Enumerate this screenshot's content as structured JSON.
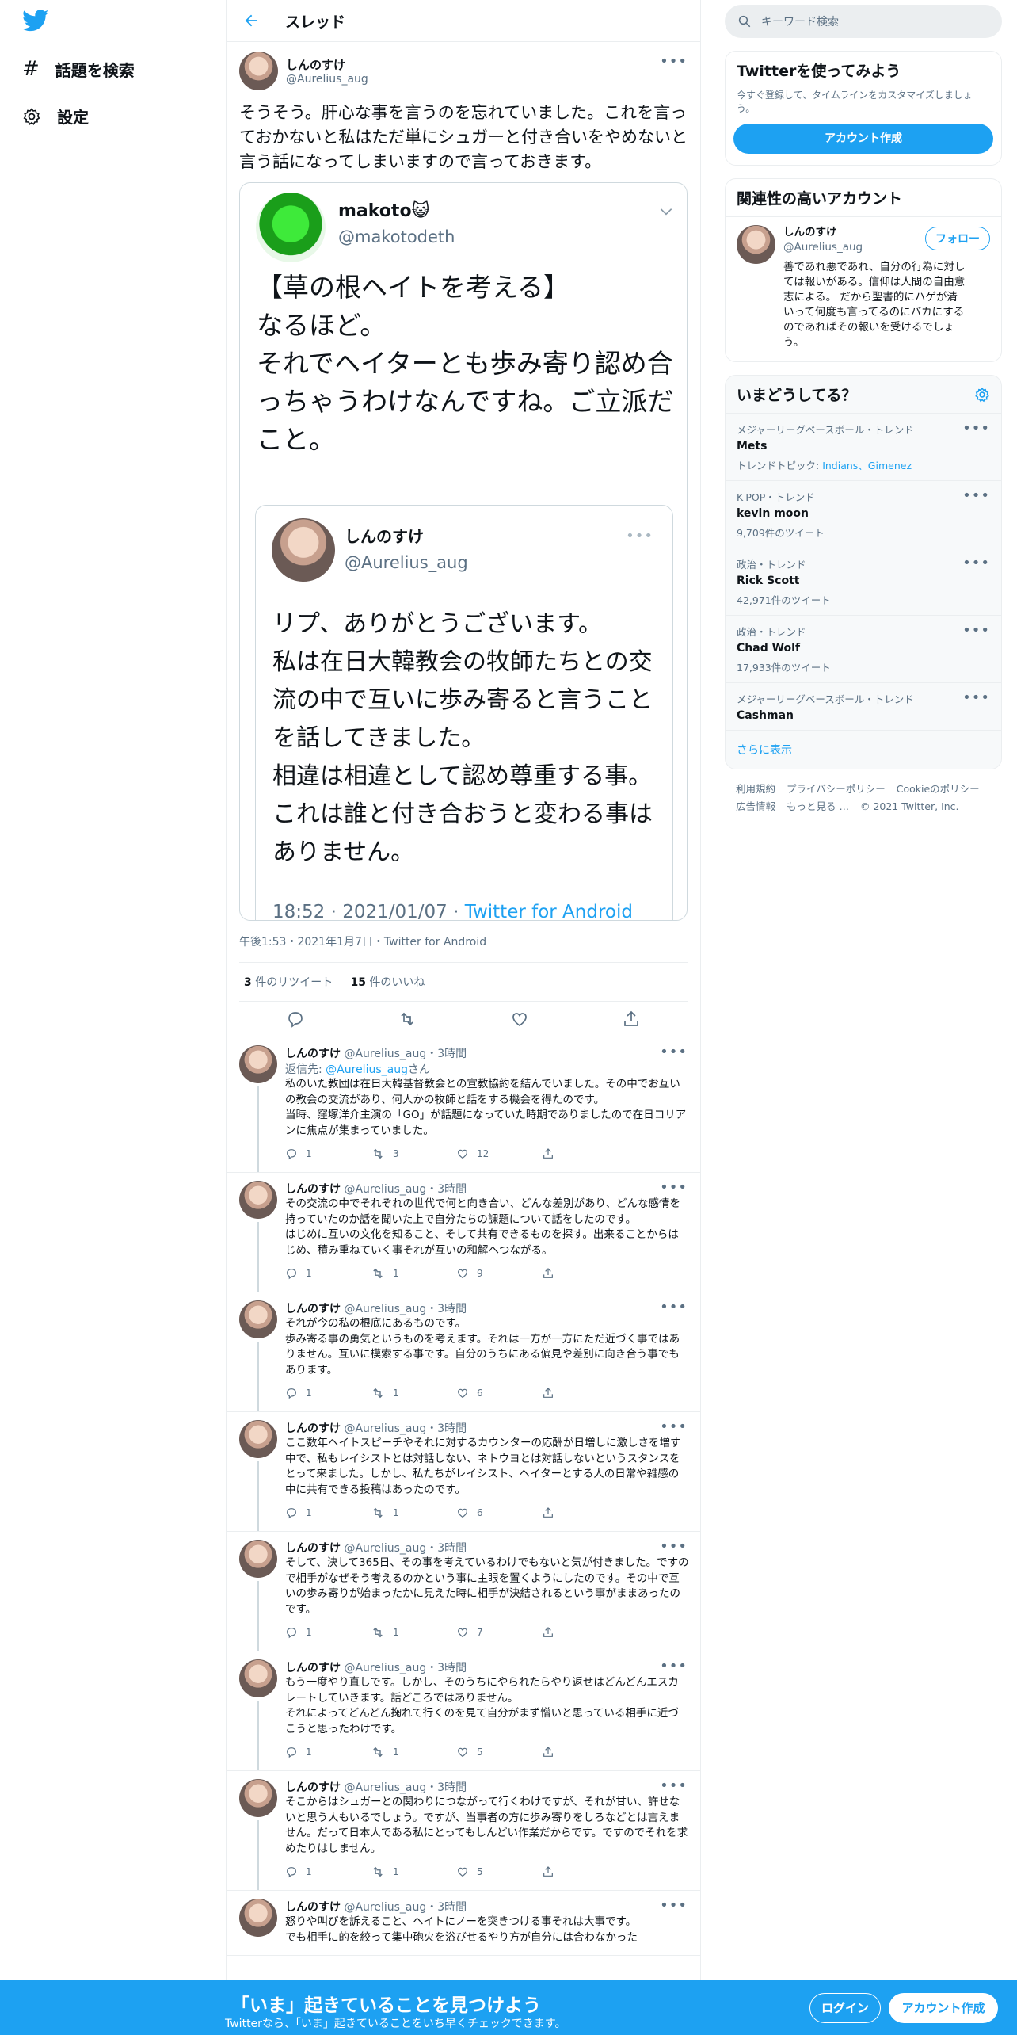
{
  "nav": {
    "explore_label": "話題を検索",
    "settings_label": "設定"
  },
  "header": {
    "title": "スレッド"
  },
  "main_tweet": {
    "name": "しんのすけ",
    "handle": "@Aurelius_aug",
    "text": "そうそう。肝心な事を言うのを忘れていました。これを言っておかないと私はただ単にシュガーと付き合いをやめないと言う話になってしまいますので言っておきます。",
    "meta": "午後1:53・2021年1月7日・Twitter for Android",
    "retweets_count": "3",
    "retweets_label": "件のリツイート",
    "likes_count": "15",
    "likes_label": "件のいいね"
  },
  "quote": {
    "name": "makoto😺",
    "handle": "@makotodeth",
    "text": "【草の根ヘイトを考える】\nなるほど。\nそれでヘイターとも歩み寄り認め合っちゃうわけなんですね。ご立派だこと。",
    "inner": {
      "name": "しんのすけ",
      "handle": "@Aurelius_aug",
      "text": "リプ、ありがとうございます。\n私は在日大韓教会の牧師たちとの交流の中で互いに歩み寄ると言うことを話してきました。\n相違は相違として認め尊重する事。これは誰と付き合おうと変わる事はありません。",
      "time": "18:52 · 2021/01/07 · ",
      "client": "Twitter for Android"
    }
  },
  "replies": [
    {
      "name": "しんのすけ",
      "handle": "@Aurelius_aug",
      "time": "・3時間",
      "reply_to_prefix": "返信先: ",
      "reply_to_handle": "@Aurelius_aug",
      "reply_to_suffix": "さん",
      "text": "私のいた教団は在日大韓基督教会との宣教協約を結んでいました。その中でお互いの教会の交流があり、何人かの牧師と話をする機会を得たのです。\n当時、窪塚洋介主演の「GO」が話題になっていた時期でありましたので在日コリアンに焦点が集まっていました。",
      "replies": "1",
      "retweets": "3",
      "likes": "12"
    },
    {
      "name": "しんのすけ",
      "handle": "@Aurelius_aug",
      "time": "・3時間",
      "text": "その交流の中でそれぞれの世代で何と向き合い、どんな差別があり、どんな感情を持っていたのか話を聞いた上で自分たちの課題について話をしたのです。\nはじめに互いの文化を知ること、そして共有できるものを探す。出来ることからはじめ、積み重ねていく事それが互いの和解へつながる。",
      "replies": "1",
      "retweets": "1",
      "likes": "9"
    },
    {
      "name": "しんのすけ",
      "handle": "@Aurelius_aug",
      "time": "・3時間",
      "text": "それが今の私の根底にあるものです。\n歩み寄る事の勇気というものを考えます。それは一方が一方にただ近づく事ではありません。互いに模索する事です。自分のうちにある偏見や差別に向き合う事でもあります。",
      "replies": "1",
      "retweets": "1",
      "likes": "6"
    },
    {
      "name": "しんのすけ",
      "handle": "@Aurelius_aug",
      "time": "・3時間",
      "text": "ここ数年ヘイトスピーチやそれに対するカウンターの応酬が日増しに激しさを増す中で、私もレイシストとは対話しない、ネトウヨとは対話しないというスタンスをとって来ました。しかし、私たちがレイシスト、ヘイターとする人の日常や雑感の中に共有できる投稿はあったのです。",
      "replies": "1",
      "retweets": "1",
      "likes": "6"
    },
    {
      "name": "しんのすけ",
      "handle": "@Aurelius_aug",
      "time": "・3時間",
      "text": "そして、決して365日、その事を考えているわけでもないと気が付きました。ですので相手がなぜそう考えるのかという事に主眼を置くようにしたのです。その中で互いの歩み寄りが始まったかに見えた時に相手が決結されるという事がままあったのです。",
      "replies": "1",
      "retweets": "1",
      "likes": "7"
    },
    {
      "name": "しんのすけ",
      "handle": "@Aurelius_aug",
      "time": "・3時間",
      "text": "もう一度やり直しです。しかし、そのうちにやられたらやり返せはどんどんエスカレートしていきます。話どころではありません。\nそれによってどんどん掬れて行くのを見て自分がまず憎いと思っている相手に近づこうと思ったわけです。",
      "replies": "1",
      "retweets": "1",
      "likes": "5"
    },
    {
      "name": "しんのすけ",
      "handle": "@Aurelius_aug",
      "time": "・3時間",
      "text": "そこからはシュガーとの関わりにつながって行くわけですが、それが甘い、許せないと思う人もいるでしょう。ですが、当事者の方に歩み寄りをしろなどとは言えません。だって日本人である私にとってもしんどい作業だからです。ですのでそれを求めたりはしません。",
      "replies": "1",
      "retweets": "1",
      "likes": "5"
    },
    {
      "name": "しんのすけ",
      "handle": "@Aurelius_aug",
      "time": "・3時間",
      "text": "怒りや叫びを訴えること、ヘイトにノーを突きつける事それは大事です。\nでも相手に的を絞って集中砲火を浴びせるやり方が自分には合わなかった",
      "replies": "",
      "retweets": "",
      "likes": ""
    }
  ],
  "right": {
    "search_placeholder": "キーワード検索",
    "join": {
      "title": "Twitterを使ってみよう",
      "subtitle": "今すぐ登録して、タイムラインをカスタマイズしましょう。",
      "button": "アカウント作成"
    },
    "related": {
      "title": "関連性の高いアカウント",
      "name": "しんのすけ",
      "handle": "@Aurelius_aug",
      "follow": "フォロー",
      "bio": "善であれ悪であれ、自分の行為に対しては報いがある。信仰は人間の自由意志による。 だから聖書的にハゲが清いって何度も言ってるのにバカにするのであればその報いを受けるでしょう。"
    },
    "trends": {
      "title": "いまどうしてる？",
      "items": [
        {
          "category": "メジャーリーグベースボール・トレンド",
          "name": "Mets",
          "extra_prefix": "トレンドトピック: ",
          "extra_links": "Indians、Gimenez"
        },
        {
          "category": "K-POP・トレンド",
          "name": "kevin moon",
          "count": "9,709件のツイート"
        },
        {
          "category": "政治・トレンド",
          "name": "Rick Scott",
          "count": "42,971件のツイート"
        },
        {
          "category": "政治・トレンド",
          "name": "Chad Wolf",
          "count": "17,933件のツイート"
        },
        {
          "category": "メジャーリーグベースボール・トレンド",
          "name": "Cashman"
        }
      ],
      "more": "さらに表示"
    },
    "footer": {
      "terms": "利用規約",
      "privacy": "プライバシーポリシー",
      "cookie": "Cookieのポリシー",
      "ads": "広告情報",
      "more": "もっと見る …",
      "copyright": "© 2021 Twitter, Inc."
    }
  },
  "bottombar": {
    "title": "「いま」起きていることを見つけよう",
    "subtitle": "Twitterなら、「いま」起きていることをいち早くチェックできます。",
    "login": "ログイン",
    "signup": "アカウント作成"
  },
  "colors": {
    "accent": "#1da1f2",
    "text": "#0f1419",
    "muted": "#5b7083",
    "border": "#ebeef0"
  }
}
